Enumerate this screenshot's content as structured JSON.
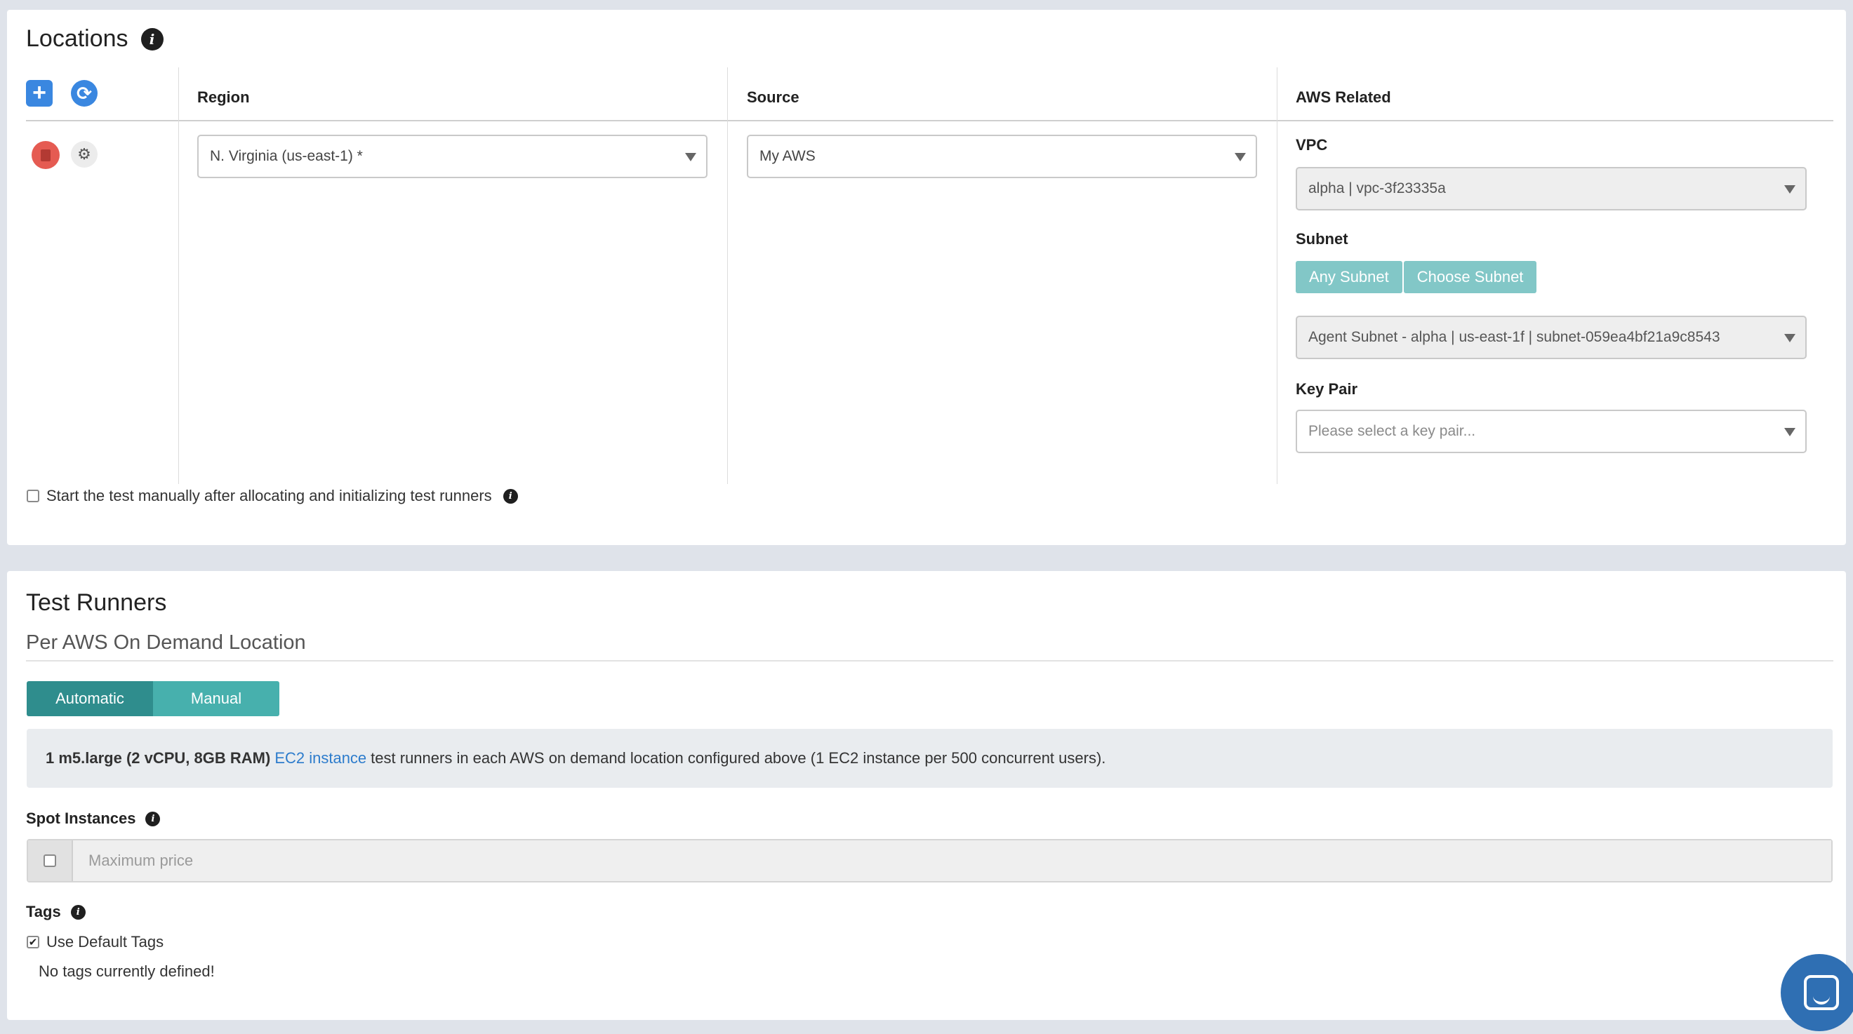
{
  "locations": {
    "title": "Locations",
    "columns": {
      "region": "Region",
      "source": "Source",
      "aws": "AWS Related"
    },
    "region_value": "N. Virginia (us-east-1) *",
    "source_value": "My AWS",
    "vpc": {
      "label": "VPC",
      "value": "alpha | vpc-3f23335a"
    },
    "subnet": {
      "label": "Subnet",
      "any_label": "Any Subnet",
      "choose_label": "Choose Subnet",
      "value": "Agent Subnet - alpha | us-east-1f | subnet-059ea4bf21a9c8543"
    },
    "keypair": {
      "label": "Key Pair",
      "placeholder": "Please select a key pair..."
    },
    "manual_start_label": "Start the test manually after allocating and initializing test runners",
    "icons": {
      "add": "plus-icon",
      "refresh": "refresh-icon",
      "delete": "trash-icon",
      "settings": "gear-icon"
    }
  },
  "runners": {
    "title": "Test Runners",
    "subtitle": "Per AWS On Demand Location",
    "mode_automatic": "Automatic",
    "mode_manual": "Manual",
    "info": {
      "spec": "1 m5.large (2 vCPU, 8GB RAM)",
      "link": "EC2 instance",
      "rest": "test runners in each AWS on demand location configured above (1 EC2 instance per 500 concurrent users)."
    },
    "spot_label": "Spot Instances",
    "spot_placeholder": "Maximum price",
    "tags_label": "Tags",
    "default_tags_label": "Use Default Tags",
    "no_tags_text": "No tags currently defined!"
  },
  "colors": {
    "primary_blue": "#3a87e0",
    "danger_red": "#e55b52",
    "teal_active": "#2f8d8d",
    "teal": "#47b0ad",
    "teal_light": "#82c7c7",
    "link_blue": "#2d7ccc"
  }
}
